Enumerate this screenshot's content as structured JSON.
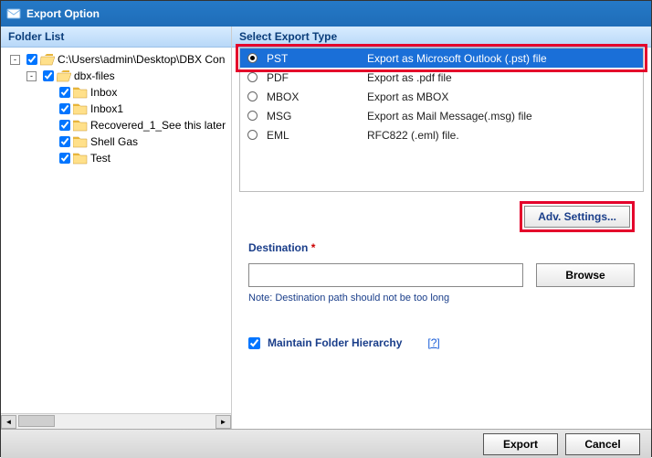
{
  "window": {
    "title": "Export Option"
  },
  "left": {
    "header": "Folder List",
    "tree": [
      {
        "indent": 0,
        "toggle": "-",
        "checked": true,
        "icon": "open",
        "label": "C:\\Users\\admin\\Desktop\\DBX Con"
      },
      {
        "indent": 1,
        "toggle": "-",
        "checked": true,
        "icon": "open",
        "label": "dbx-files"
      },
      {
        "indent": 2,
        "toggle": "",
        "checked": true,
        "icon": "closed",
        "label": "Inbox"
      },
      {
        "indent": 2,
        "toggle": "",
        "checked": true,
        "icon": "closed",
        "label": "Inbox1"
      },
      {
        "indent": 2,
        "toggle": "",
        "checked": true,
        "icon": "closed",
        "label": "Recovered_1_See this later"
      },
      {
        "indent": 2,
        "toggle": "",
        "checked": true,
        "icon": "closed",
        "label": "Shell Gas"
      },
      {
        "indent": 2,
        "toggle": "",
        "checked": true,
        "icon": "closed",
        "label": "Test"
      }
    ]
  },
  "right": {
    "header": "Select Export Type",
    "types": [
      {
        "code": "PST",
        "desc": "Export as Microsoft Outlook (.pst) file",
        "selected": true
      },
      {
        "code": "PDF",
        "desc": "Export as .pdf file",
        "selected": false
      },
      {
        "code": "MBOX",
        "desc": "Export as MBOX",
        "selected": false
      },
      {
        "code": "MSG",
        "desc": "Export as Mail Message(.msg) file",
        "selected": false
      },
      {
        "code": "EML",
        "desc": "RFC822 (.eml) file.",
        "selected": false
      }
    ],
    "adv_button": "Adv. Settings...",
    "destination_label": "Destination",
    "destination_required": "*",
    "destination_value": "",
    "browse": "Browse",
    "note": "Note: Destination path should not be too long",
    "maintain_label": "Maintain Folder Hierarchy",
    "maintain_checked": true,
    "help": "[?]"
  },
  "footer": {
    "export": "Export",
    "cancel": "Cancel"
  }
}
